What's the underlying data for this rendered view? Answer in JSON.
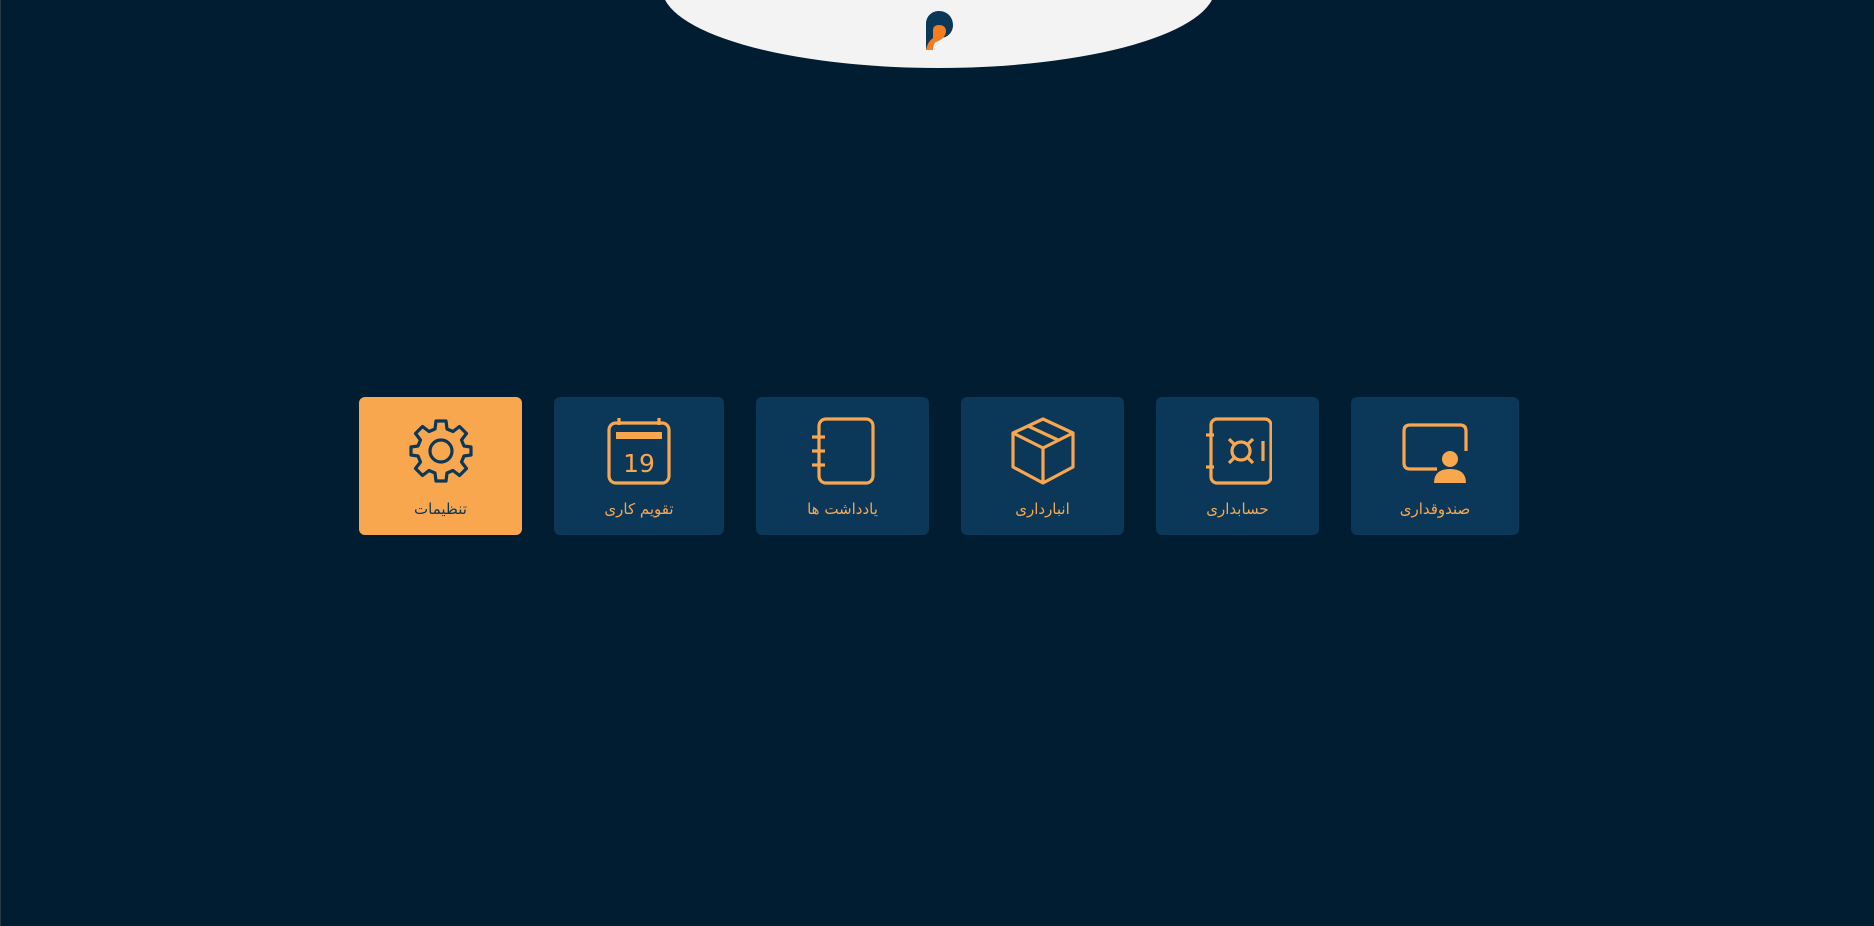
{
  "colors": {
    "background": "#011d32",
    "tile": "#0b3758",
    "accent": "#f9a74f",
    "header_cap": "#f3f3f3",
    "logo_orange": "#f57c1f"
  },
  "header": {
    "logo_icon": "p-logo-icon"
  },
  "tiles": [
    {
      "label": "تنظیمات",
      "icon": "gear-icon",
      "active": true
    },
    {
      "label": "تقویم کاری",
      "icon": "calendar-icon",
      "icon_text": "19",
      "active": false
    },
    {
      "label": "یادداشت ها",
      "icon": "notebook-icon",
      "active": false
    },
    {
      "label": "انبارداری",
      "icon": "box-icon",
      "active": false
    },
    {
      "label": "حسابداری",
      "icon": "safe-icon",
      "active": false
    },
    {
      "label": "صندوقداری",
      "icon": "cashier-icon",
      "active": false
    }
  ]
}
